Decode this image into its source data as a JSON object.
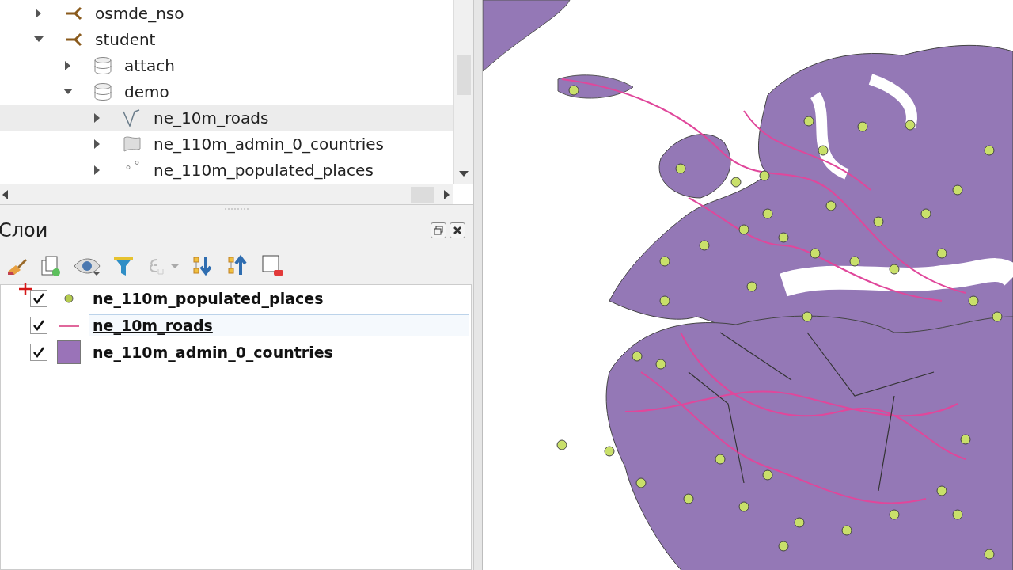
{
  "browser_tree": {
    "items": [
      {
        "label": "osmde_nso",
        "kind": "schema",
        "expanded": false,
        "selected": false
      },
      {
        "label": "student",
        "kind": "schema",
        "expanded": true,
        "selected": false,
        "children": [
          {
            "label": "attach",
            "kind": "database",
            "expanded": false,
            "selected": false
          },
          {
            "label": "demo",
            "kind": "database",
            "expanded": true,
            "selected": false,
            "children": [
              {
                "label": "ne_10m_roads",
                "kind": "line",
                "expanded": false,
                "selected": true
              },
              {
                "label": "ne_110m_admin_0_countries",
                "kind": "polygon",
                "expanded": false,
                "selected": false
              },
              {
                "label": "ne_110m_populated_places",
                "kind": "point",
                "expanded": false,
                "selected": false
              }
            ]
          }
        ]
      }
    ]
  },
  "layers_panel": {
    "title": "Слои",
    "layers": [
      {
        "name": "ne_110m_populated_places",
        "checked": true,
        "kind": "point",
        "color": "#b5cc4e",
        "selected": false
      },
      {
        "name": "ne_10m_roads",
        "checked": true,
        "kind": "line",
        "color": "#e0679b",
        "selected": true
      },
      {
        "name": "ne_110m_admin_0_countries",
        "checked": true,
        "kind": "fill",
        "color": "#9a73b8",
        "selected": false
      }
    ]
  }
}
